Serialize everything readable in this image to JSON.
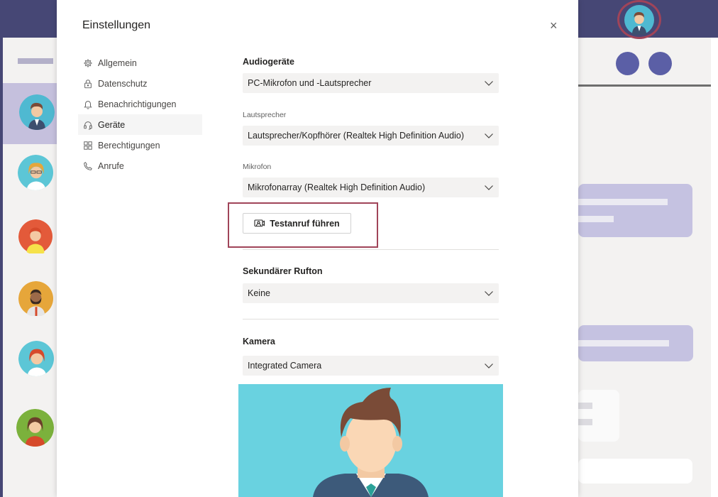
{
  "dialog": {
    "title": "Einstellungen",
    "close_label": "×"
  },
  "nav": {
    "items": [
      {
        "label": "Allgemein",
        "icon": "gear-icon"
      },
      {
        "label": "Datenschutz",
        "icon": "lock-icon"
      },
      {
        "label": "Benachrichtigungen",
        "icon": "bell-icon"
      },
      {
        "label": "Geräte",
        "icon": "headset-icon",
        "active": true
      },
      {
        "label": "Berechtigungen",
        "icon": "grid-icon"
      },
      {
        "label": "Anrufe",
        "icon": "phone-icon"
      }
    ]
  },
  "audio": {
    "heading": "Audiogeräte",
    "device": "PC-Mikrofon und -Lautsprecher",
    "speaker_label": "Lautsprecher",
    "speaker": "Lautsprecher/Kopfhörer (Realtek High Definition Audio)",
    "mic_label": "Mikrofon",
    "mic": "Mikrofonarray (Realtek High Definition Audio)",
    "test_button": "Testanruf führen"
  },
  "ringtone": {
    "heading": "Sekundärer Rufton",
    "value": "Keine"
  },
  "camera": {
    "heading": "Kamera",
    "value": "Integrated Camera"
  },
  "colors": {
    "brand": "#464775",
    "accent_highlight": "#a04459",
    "camera_bg": "#69d2e0"
  }
}
